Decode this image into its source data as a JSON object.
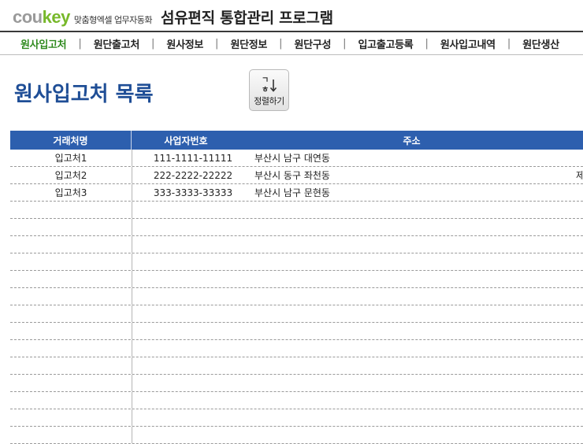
{
  "header": {
    "logo_cou": "cou",
    "logo_key": "key",
    "tagline": "맞춤형엑셀 업무자동화",
    "app_title": "섬유편직 통합관리 프로그램"
  },
  "nav": {
    "items": [
      {
        "label": "원사입고처",
        "active": true
      },
      {
        "label": "원단출고처"
      },
      {
        "label": "원사정보"
      },
      {
        "label": "원단정보"
      },
      {
        "label": "원단구성"
      },
      {
        "label": "입고출고등록"
      },
      {
        "label": "원사입고내역"
      },
      {
        "label": "원단생산"
      }
    ],
    "separator": "|"
  },
  "page": {
    "title": "원사입고처 목록",
    "sort_button_label": "정렬하기",
    "sort_icon": "sort-az-icon"
  },
  "table": {
    "columns": [
      "거래처명",
      "사업자번호",
      "주소"
    ],
    "rows": [
      [
        "입고처1",
        "111-1111-11111",
        "부산시 남구 대연동",
        ""
      ],
      [
        "입고처2",
        "222-2222-22222",
        "부산시 동구 좌천동",
        "제"
      ],
      [
        "입고처3",
        "333-3333-33333",
        "부산시 남구 문현동",
        ""
      ],
      [
        "",
        "",
        "",
        ""
      ],
      [
        "",
        "",
        "",
        ""
      ],
      [
        "",
        "",
        "",
        ""
      ],
      [
        "",
        "",
        "",
        ""
      ],
      [
        "",
        "",
        "",
        ""
      ],
      [
        "",
        "",
        "",
        ""
      ],
      [
        "",
        "",
        "",
        ""
      ],
      [
        "",
        "",
        "",
        ""
      ],
      [
        "",
        "",
        "",
        ""
      ],
      [
        "",
        "",
        "",
        ""
      ],
      [
        "",
        "",
        "",
        ""
      ],
      [
        "",
        "",
        "",
        ""
      ],
      [
        "",
        "",
        "",
        ""
      ],
      [
        "",
        "",
        "",
        ""
      ]
    ]
  },
  "colors": {
    "brand_green": "#77b82a",
    "active_nav": "#2f8a1e",
    "title_blue": "#1f4e96",
    "header_blue": "#2d5fae"
  }
}
